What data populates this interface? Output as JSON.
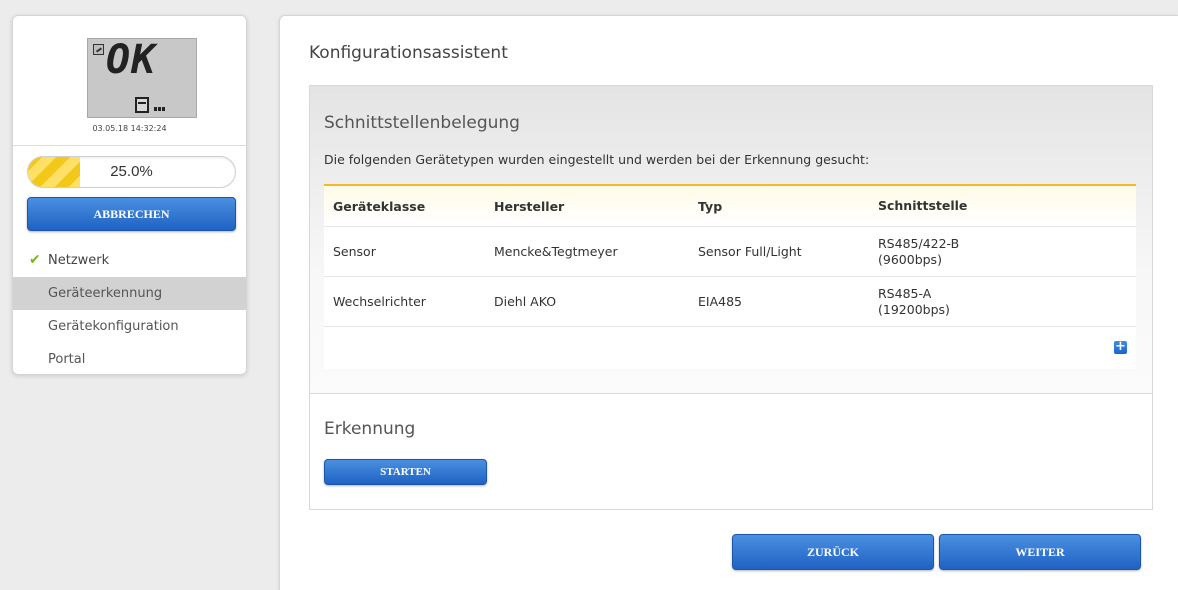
{
  "device": {
    "display_text": "OK",
    "timestamp": "03.05.18 14:32:24"
  },
  "progress": {
    "value": 0.25,
    "label": "25.0%"
  },
  "abort_button": "ABBRECHEN",
  "steps": [
    {
      "label": "Netzwerk",
      "state": "done"
    },
    {
      "label": "Geräteerkennung",
      "state": "active"
    },
    {
      "label": "Gerätekonfiguration",
      "state": "pending"
    },
    {
      "label": "Portal",
      "state": "pending"
    }
  ],
  "page_title": "Konfigurationsassistent",
  "interface_section": {
    "title": "Schnittstellenbelegung",
    "description": "Die folgenden Gerätetypen wurden eingestellt und werden bei der Erkennung gesucht:",
    "columns": [
      "Geräteklasse",
      "Hersteller",
      "Typ",
      "Schnittstelle"
    ],
    "rows": [
      {
        "klasse": "Sensor",
        "hersteller": "Mencke&Tegtmeyer",
        "typ": "Sensor Full/Light",
        "schnittstelle_line1": "RS485/422-B",
        "schnittstelle_line2": "(9600bps)"
      },
      {
        "klasse": "Wechselrichter",
        "hersteller": "Diehl AKO",
        "typ": "EIA485",
        "schnittstelle_line1": "RS485-A",
        "schnittstelle_line2": "(19200bps)"
      }
    ],
    "add_icon": "plus-icon"
  },
  "detection_section": {
    "title": "Erkennung",
    "start_button": "STARTEN"
  },
  "nav_buttons": {
    "back": "ZURÜCK",
    "next": "WEITER"
  },
  "colors": {
    "button_blue": "#1f62c4",
    "table_accent": "#f5b82a",
    "progress_yellow": "#f2c81a",
    "check_green": "#7ab51d"
  }
}
